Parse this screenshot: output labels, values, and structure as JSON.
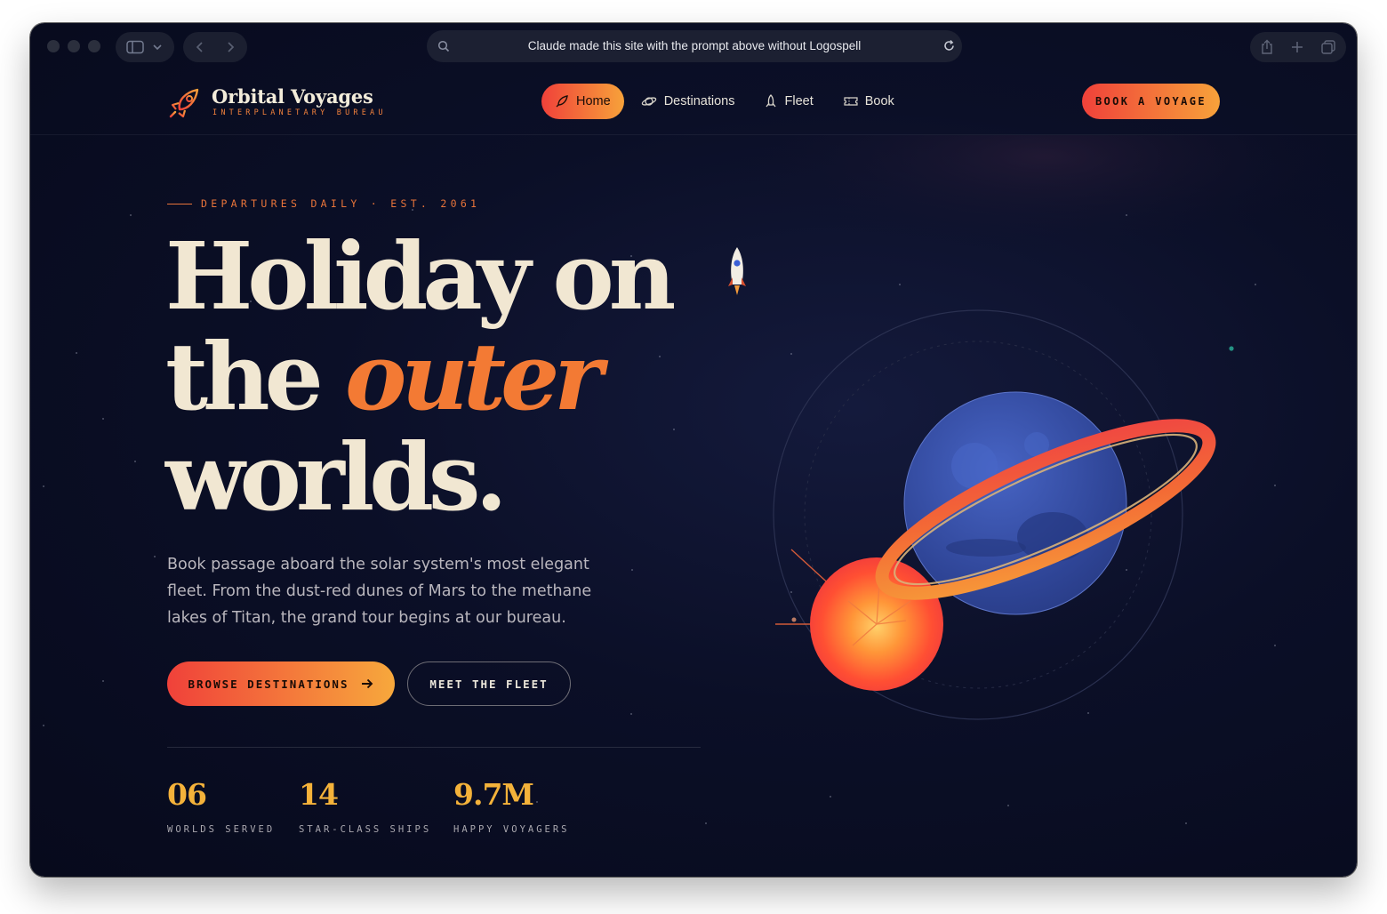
{
  "browser": {
    "url_text": "Claude made this site with the prompt above without Logospell",
    "icons": [
      "sidebar-icon",
      "chevron-down-icon",
      "back-icon",
      "forward-icon",
      "search-icon",
      "reload-icon",
      "share-icon",
      "new-tab-icon",
      "tabs-icon"
    ]
  },
  "nav": {
    "brand": "Orbital Voyages",
    "brand_sub": "INTERPLANETARY BUREAU",
    "links": [
      {
        "label": "Home",
        "icon": "rocket-icon",
        "active": true
      },
      {
        "label": "Destinations",
        "icon": "planet-icon",
        "active": false
      },
      {
        "label": "Fleet",
        "icon": "ship-icon",
        "active": false
      },
      {
        "label": "Book",
        "icon": "ticket-icon",
        "active": false
      }
    ],
    "cta": "BOOK A VOYAGE"
  },
  "hero": {
    "eyebrow": "DEPARTURES DAILY · EST. 2061",
    "headline_line1": "Holiday on",
    "headline_line2_pre": "the",
    "headline_accent": "outer",
    "headline_line3": "worlds.",
    "description": "Book passage aboard the solar system's most elegant fleet. From the dust-red dunes of Mars to the methane lakes of Titan, the grand tour begins at our bureau.",
    "primary_button": "BROWSE DESTINATIONS",
    "secondary_button": "MEET THE FLEET"
  },
  "stats": [
    {
      "value": "06",
      "label": "WORLDS SERVED"
    },
    {
      "value": "14",
      "label": "STAR-CLASS SHIPS"
    },
    {
      "value": "9.7M",
      "label": "HAPPY VOYAGERS"
    }
  ],
  "colors": {
    "accent_orange": "#f37a34",
    "gradient_start": "#f0413a",
    "gradient_end": "#f7a23a",
    "stat_gold": "#f4b23a",
    "cream": "#f1e7d2",
    "planet_blue": "#3a55b0",
    "background": "#0b0f27"
  }
}
